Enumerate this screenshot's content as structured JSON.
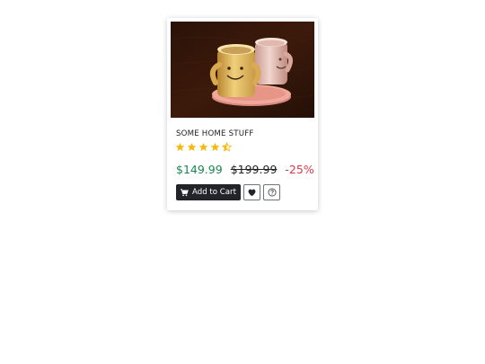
{
  "product": {
    "title": "SOME HOME STUFF",
    "rating": 4.5,
    "rating_max": 5,
    "price": "$149.99",
    "old_price": "$199.99",
    "discount": "-25%",
    "image_description": "Two smiling ceramic mugs on a pink tray on a wooden table"
  },
  "actions": {
    "add_to_cart_label": "Add to Cart",
    "cart_icon": "cart-icon",
    "wishlist_icon": "heart-icon",
    "help_icon": "question-circle-icon"
  },
  "colors": {
    "star": "#f5b80b",
    "price": "#198754",
    "discount": "#dc3545",
    "button_dark": "#212529"
  }
}
